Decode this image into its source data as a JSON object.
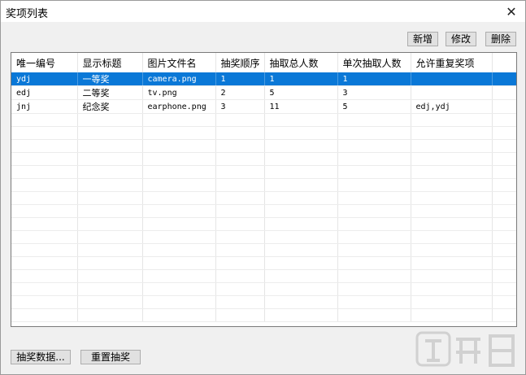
{
  "window": {
    "title": "奖项列表",
    "close_icon": "close-icon"
  },
  "toolbar": {
    "add_label": "新增",
    "edit_label": "修改",
    "delete_label": "删除"
  },
  "table": {
    "columns": [
      "唯一编号",
      "显示标题",
      "图片文件名",
      "抽奖顺序",
      "抽取总人数",
      "单次抽取人数",
      "允许重复奖项"
    ],
    "rows": [
      [
        "ydj",
        "一等奖",
        "camera.png",
        "1",
        "1",
        "1",
        ""
      ],
      [
        "edj",
        "二等奖",
        "tv.png",
        "2",
        "5",
        "3",
        ""
      ],
      [
        "jnj",
        "纪念奖",
        "earphone.png",
        "3",
        "11",
        "5",
        "edj,ydj"
      ]
    ],
    "selected_row": 0
  },
  "footer": {
    "lottery_data_label": "抽奖数据...",
    "reset_label": "重置抽奖"
  },
  "watermark": {
    "text": "下载吧"
  }
}
